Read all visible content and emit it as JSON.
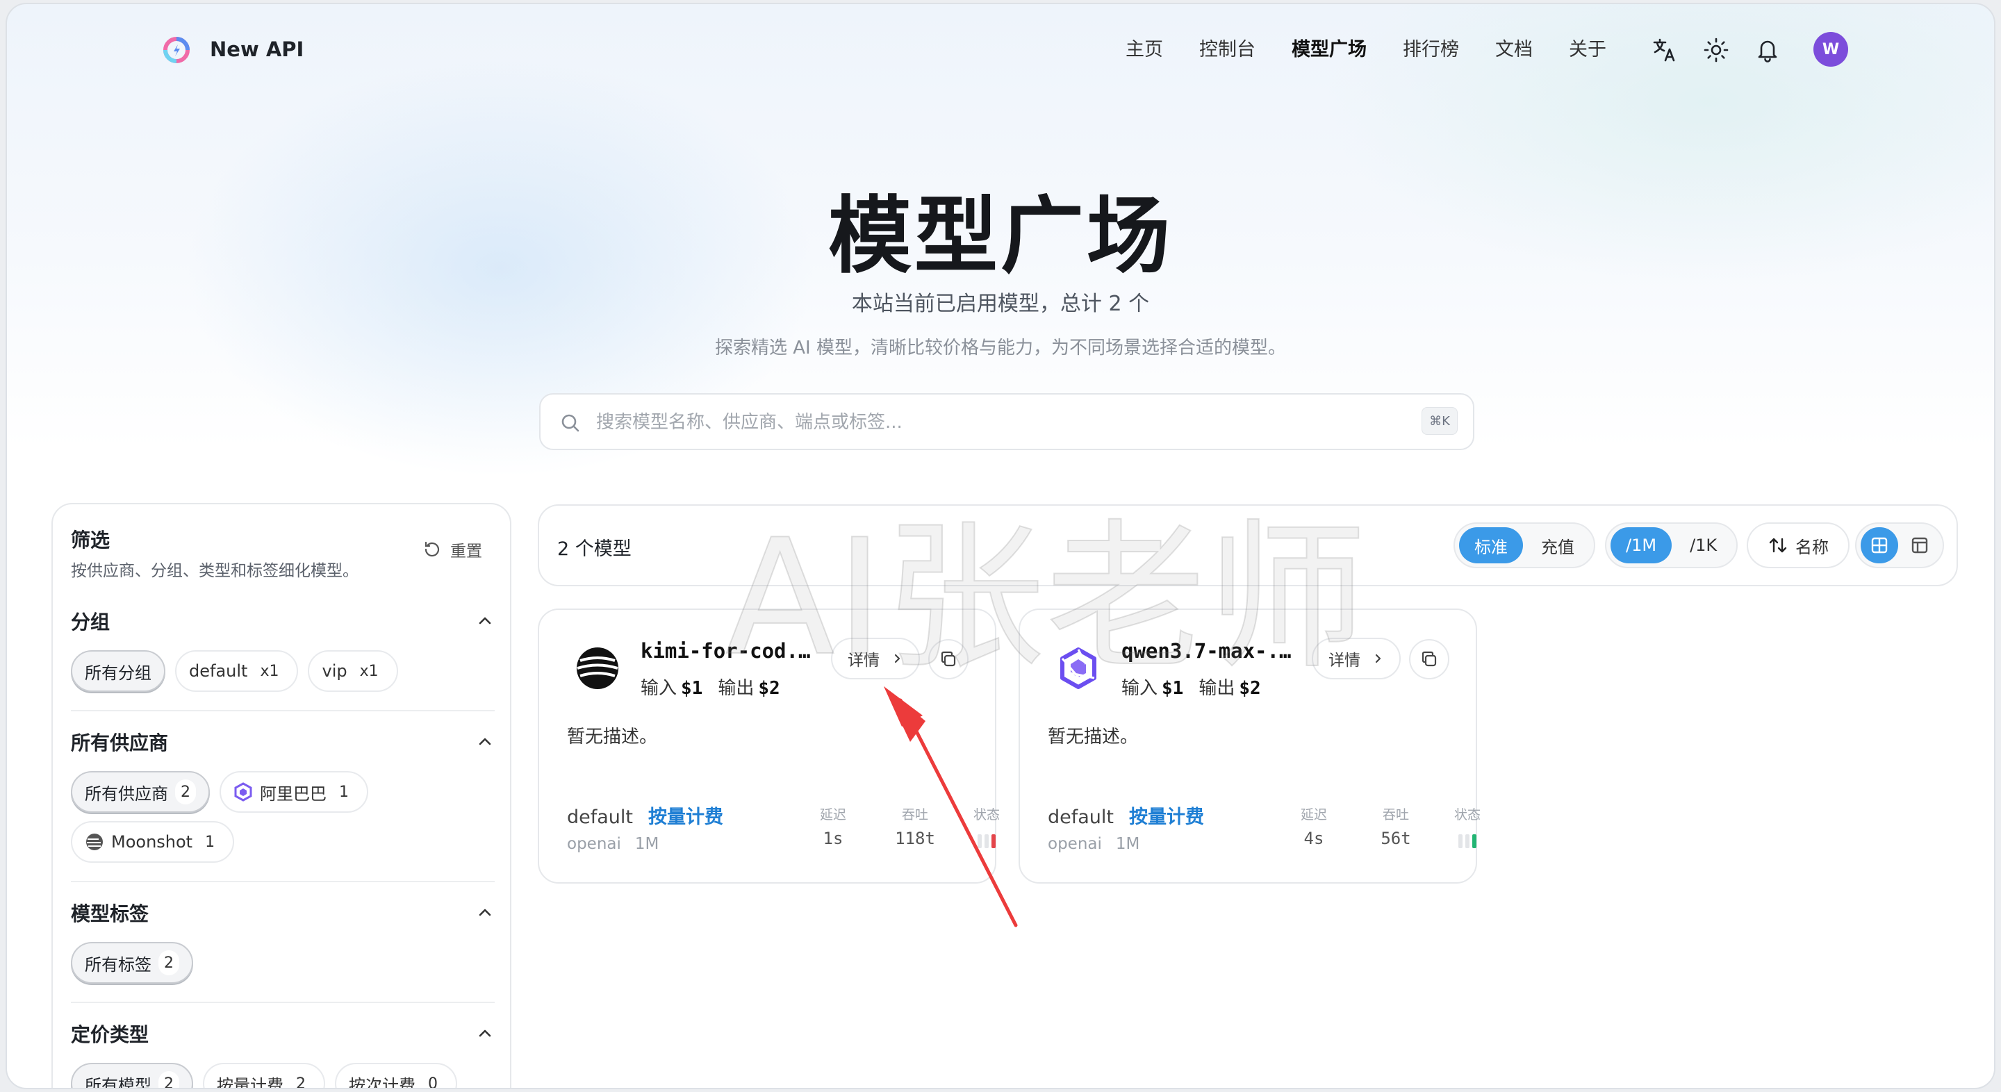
{
  "nav": {
    "brand": "New API",
    "links": [
      "主页",
      "控制台",
      "模型广场",
      "排行榜",
      "文档",
      "关于"
    ],
    "active_link": "模型广场",
    "avatar_letter": "W",
    "icons": [
      "translate-icon",
      "sun-icon",
      "bell-icon"
    ]
  },
  "hero": {
    "title": "模型广场",
    "subtitle": "本站当前已启用模型，总计 2 个",
    "description": "探索精选 AI 模型，清晰比较价格与能力，为不同场景选择合适的模型。"
  },
  "search": {
    "placeholder": "搜索模型名称、供应商、端点或标签...",
    "shortcut": "⌘K"
  },
  "sidebar": {
    "title": "筛选",
    "description": "按供应商、分组、类型和标签细化模型。",
    "reset_label": "重置",
    "sections": {
      "group": {
        "title": "分组",
        "chips": [
          {
            "label": "所有分组",
            "count": "",
            "selected": true
          },
          {
            "label": "default",
            "count": "x1",
            "selected": false
          },
          {
            "label": "vip",
            "count": "x1",
            "selected": false
          }
        ]
      },
      "vendor": {
        "title": "所有供应商",
        "chips": [
          {
            "label": "所有供应商",
            "count": "2",
            "selected": true
          },
          {
            "label": "阿里巴巴",
            "count": "1",
            "selected": false,
            "icon": "qwen-icon"
          },
          {
            "label": "Moonshot",
            "count": "1",
            "selected": false,
            "icon": "moonshot-icon"
          }
        ]
      },
      "tags": {
        "title": "模型标签",
        "chips": [
          {
            "label": "所有标签",
            "count": "2",
            "selected": true
          }
        ]
      },
      "pricing": {
        "title": "定价类型",
        "chips": [
          {
            "label": "所有模型",
            "count": "2",
            "selected": true
          },
          {
            "label": "按量计费",
            "count": "2",
            "selected": false
          },
          {
            "label": "按次计费",
            "count": "0",
            "selected": false
          }
        ]
      }
    }
  },
  "toolbar": {
    "count": "2 个模型",
    "price_mode": {
      "standard": "标准",
      "recharge": "充值"
    },
    "unit": {
      "per_m": "/1M",
      "per_k": "/1K"
    },
    "sort_label": "名称",
    "colors": {
      "accent": "#3b9ae8"
    }
  },
  "cards": [
    {
      "name": "kimi-for-cod...",
      "price": {
        "input_label": "输入",
        "input": "$1",
        "output_label": "输出",
        "output": "$2"
      },
      "detail_label": "详情",
      "description": "暂无描述。",
      "group": "default",
      "billing": "按量计费",
      "endpoint": "openai",
      "unit": "1M",
      "stats": {
        "latency_label": "延迟",
        "latency": "1s",
        "throughput_label": "吞吐",
        "throughput": "118t",
        "status_label": "状态"
      },
      "icon": "moonshot-icon"
    },
    {
      "name": "qwen3.7-max-...",
      "price": {
        "input_label": "输入",
        "input": "$1",
        "output_label": "输出",
        "output": "$2"
      },
      "detail_label": "详情",
      "description": "暂无描述。",
      "group": "default",
      "billing": "按量计费",
      "endpoint": "openai",
      "unit": "1M",
      "stats": {
        "latency_label": "延迟",
        "latency": "4s",
        "throughput_label": "吞吐",
        "throughput": "56t",
        "status_label": "状态"
      },
      "icon": "qwen-icon"
    }
  ],
  "watermark": "AI张老师"
}
